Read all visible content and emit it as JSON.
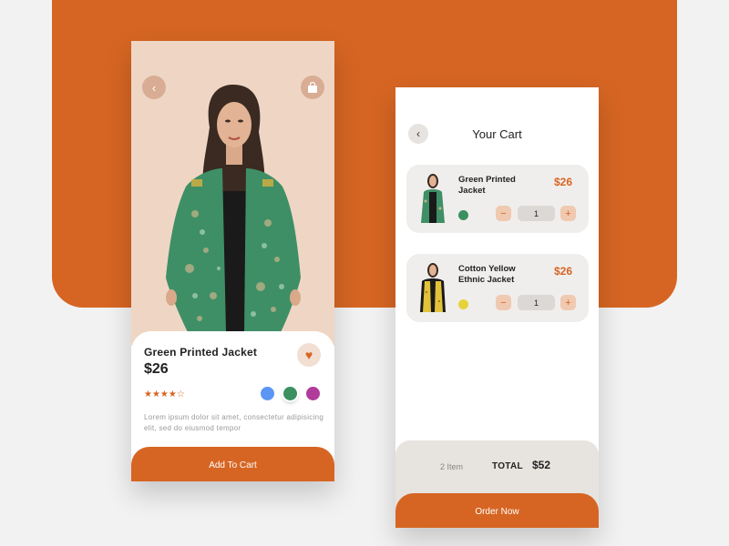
{
  "product": {
    "title": "Green Printed Jacket",
    "price": "$26",
    "rating": 4,
    "rating_max": 5,
    "stars": "★★★★☆",
    "description": "Lorem ipsum dolor sit amet, consectetur adipisicing elit, sed do eiusmod tempor",
    "colors": [
      "#5b95f5",
      "#3b9060",
      "#b03b9a"
    ],
    "selected_color": "#3b9060",
    "add_to_cart_label": "Add To Cart",
    "back_icon": "‹",
    "bag_icon": "bag",
    "heart_icon": "♥"
  },
  "cart": {
    "title": "Your Cart",
    "back_icon": "‹",
    "items": [
      {
        "name": "Green Printed Jacket",
        "price": "$26",
        "color": "#3b9060",
        "quantity": "1",
        "minus": "−",
        "plus": "+"
      },
      {
        "name": "Cotton Yellow Ethnic Jacket",
        "price": "$26",
        "color": "#e8d23a",
        "quantity": "1",
        "minus": "−",
        "plus": "+"
      }
    ],
    "item_count": "2 Item",
    "total_label": "TOTAL",
    "total_value": "$52",
    "order_label": "Order Now"
  },
  "colors": {
    "accent": "#d66523",
    "background": "#f2f2f2",
    "hero_bg": "#efd6c4"
  }
}
